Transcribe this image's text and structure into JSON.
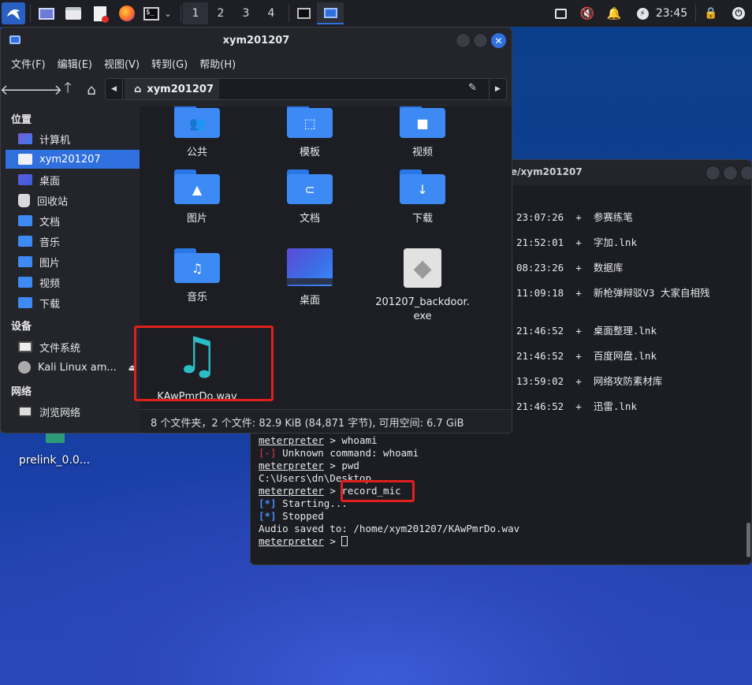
{
  "taskbar": {
    "workspaces": [
      "1",
      "2",
      "3",
      "4"
    ],
    "clock": "23:45"
  },
  "desktop": {
    "icon_label": "prelink_0.0..."
  },
  "filemanager": {
    "title": "xym201207",
    "menu": [
      "文件(F)",
      "编辑(E)",
      "视图(V)",
      "转到(G)",
      "帮助(H)"
    ],
    "path": "xym201207",
    "sidebar": {
      "places_header": "位置",
      "places": [
        "计算机",
        "xym201207",
        "桌面",
        "回收站",
        "文档",
        "音乐",
        "图片",
        "视频",
        "下载"
      ],
      "devices_header": "设备",
      "devices": [
        "文件系统",
        "Kali Linux am..."
      ],
      "network_header": "网络",
      "network": [
        "浏览网络"
      ]
    },
    "items": [
      {
        "label": "公共",
        "icon": "public-folder-icon",
        "glyph": "👥"
      },
      {
        "label": "模板",
        "icon": "templates-folder-icon",
        "glyph": "⬚"
      },
      {
        "label": "视频",
        "icon": "videos-folder-icon",
        "glyph": "■"
      },
      {
        "label": "图片",
        "icon": "pictures-folder-icon",
        "glyph": "▲"
      },
      {
        "label": "文档",
        "icon": "documents-folder-icon",
        "glyph": "⊂"
      },
      {
        "label": "下载",
        "icon": "downloads-folder-icon",
        "glyph": "↓"
      },
      {
        "label": "音乐",
        "icon": "music-folder-icon",
        "glyph": "♫"
      },
      {
        "label": "桌面",
        "icon": "desktop-folder-icon",
        "glyph": "…"
      },
      {
        "label": "201207_backdoor.exe",
        "icon": "exe-file-icon",
        "glyph": "◆"
      },
      {
        "label": "KAwPmrDo.wav",
        "icon": "audio-file-icon",
        "glyph": "♫"
      }
    ],
    "status": "8 个文件夹，2 个文件: 82.9 KiB (84,871 字节), 可用空间: 6.7 GiB"
  },
  "terminal": {
    "title": "e/xym201207",
    "listing": [
      {
        "time": "23:07:26",
        "name": "参赛练笔"
      },
      {
        "time": "21:52:01",
        "name": "字加.lnk"
      },
      {
        "time": "08:23:26",
        "name": "数据库"
      },
      {
        "time": "11:09:18",
        "name": "新枪弹辩驳V3 大家自相残"
      },
      {
        "time": "21:46:52",
        "name": "桌面整理.lnk"
      },
      {
        "time": "21:46:52",
        "name": "百度网盘.lnk"
      },
      {
        "time": "13:59:02",
        "name": "网络攻防素材库"
      },
      {
        "time": "21:46:52",
        "name": "迅雷.lnk"
      }
    ],
    "plus": "+",
    "prompt": "meterpreter",
    "cmd1": "whoami",
    "err_tag": "[-]",
    "err_text": "Unknown command: whoami",
    "cmd2": "pwd",
    "pwd_out": "C:\\Users\\dn\\Desktop",
    "cmd3": "record_mic",
    "info_tag": "[*]",
    "starting": "Starting...",
    "stopped": "Stopped",
    "saved": "Audio saved to: /home/xym201207/KAwPmrDo.wav"
  }
}
